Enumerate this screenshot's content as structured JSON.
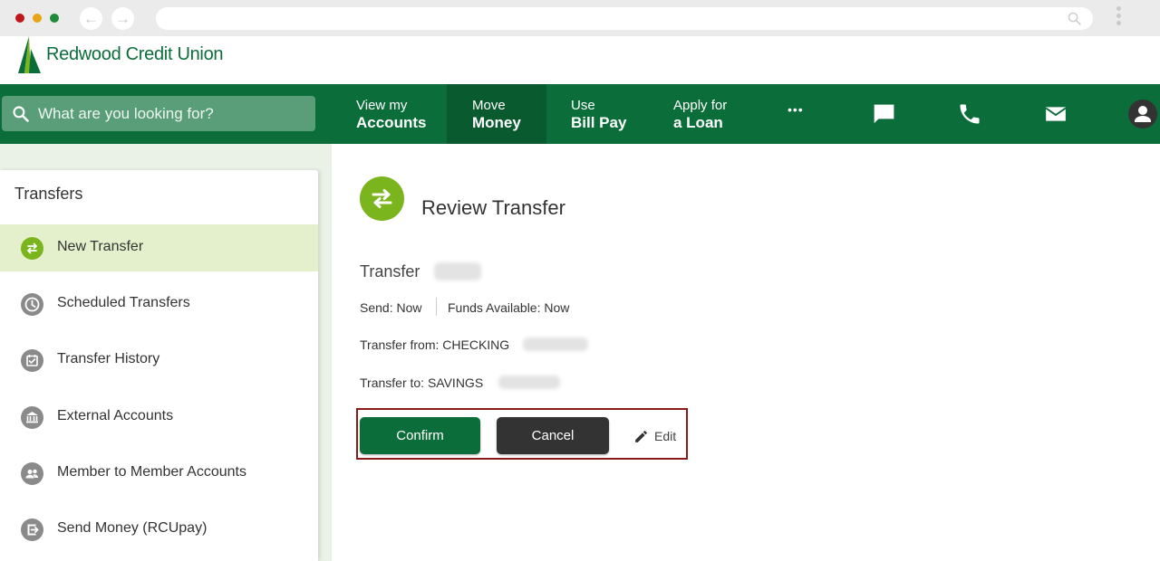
{
  "browser": {
    "back_glyph": "←",
    "forward_glyph": "→"
  },
  "brand": {
    "name": "Redwood Credit Union",
    "color": "#0b6e3a",
    "accent": "#7ab51d"
  },
  "search": {
    "placeholder": "What are you looking for?"
  },
  "nav": {
    "accounts": {
      "line1": "View my",
      "line2": "Accounts"
    },
    "move": {
      "line1": "Move",
      "line2": "Money"
    },
    "billpay": {
      "line1": "Use",
      "line2": "Bill Pay"
    },
    "loan": {
      "line1": "Apply for",
      "line2": "a Loan"
    },
    "more_label": "•••",
    "icons": [
      "chat-icon",
      "phone-icon",
      "mail-icon",
      "user-icon"
    ]
  },
  "sidebar": {
    "title": "Transfers",
    "items": [
      {
        "label": "New Transfer",
        "icon": "transfer-icon",
        "active": true
      },
      {
        "label": "Scheduled Transfers",
        "icon": "clock-icon"
      },
      {
        "label": "Transfer History",
        "icon": "calendar-check-icon"
      },
      {
        "label": "External Accounts",
        "icon": "bank-icon"
      },
      {
        "label": "Member to Member Accounts",
        "icon": "members-icon"
      },
      {
        "label": "Send Money (RCUpay)",
        "icon": "send-money-icon"
      }
    ]
  },
  "review": {
    "title": "Review Transfer",
    "transfer_label": "Transfer",
    "send": "Send: Now",
    "funds_available": "Funds Available: Now",
    "from": "Transfer from: CHECKING",
    "to": "Transfer to: SAVINGS",
    "confirm_label": "Confirm",
    "cancel_label": "Cancel",
    "edit_label": "Edit"
  }
}
